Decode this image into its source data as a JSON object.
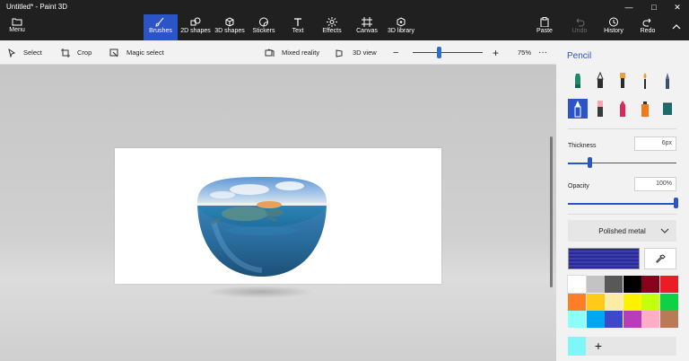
{
  "window": {
    "title": "Untitled* - Paint 3D"
  },
  "ribbon": {
    "menu": "Menu",
    "tabs": [
      {
        "label": "Brushes"
      },
      {
        "label": "2D shapes"
      },
      {
        "label": "3D shapes"
      },
      {
        "label": "Stickers"
      },
      {
        "label": "Text"
      },
      {
        "label": "Effects"
      },
      {
        "label": "Canvas"
      },
      {
        "label": "3D library"
      }
    ],
    "active_tab": "Brushes",
    "actions": [
      {
        "label": "Paste"
      },
      {
        "label": "Undo"
      },
      {
        "label": "History"
      },
      {
        "label": "Redo"
      }
    ]
  },
  "toolbar": {
    "select": "Select",
    "crop": "Crop",
    "magic_select": "Magic select",
    "mixed_reality": "Mixed reality",
    "view_3d": "3D view",
    "zoom": "75%",
    "zoom_level": 0.37
  },
  "panel": {
    "title": "Pencil",
    "tools": [
      "marker",
      "calligraphy-pen",
      "oil-brush",
      "watercolor",
      "pixel-pen",
      "pencil",
      "eraser",
      "crayon",
      "spray-can",
      "fill"
    ],
    "selected_tool": "pencil",
    "thickness_label": "Thickness",
    "thickness_value": "6px",
    "thickness_fraction": 0.2,
    "opacity_label": "Opacity",
    "opacity_value": "100%",
    "opacity_fraction": 1.0,
    "material": "Polished metal",
    "current_color": "#2a2b8a",
    "palette": [
      "#ffffff",
      "#c3c3c3",
      "#585858",
      "#000000",
      "#88001b",
      "#ec1c24",
      "#ff7f27",
      "#ffca18",
      "#fdeca6",
      "#fff200",
      "#c4ff0e",
      "#0ed145",
      "#8cfffb",
      "#00a8f3",
      "#3f48cc",
      "#b83dba",
      "#ffaec8",
      "#b97a56"
    ],
    "custom_color": "#7ff7f8"
  },
  "accent": "#2b54c7"
}
